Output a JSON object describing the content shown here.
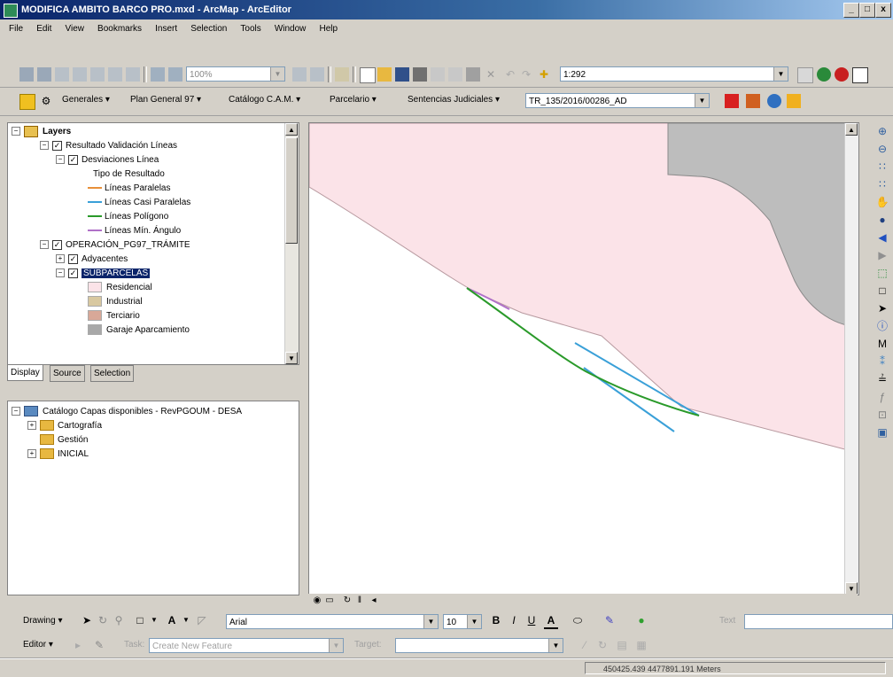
{
  "window": {
    "title": "MODIFICA AMBITO BARCO PRO.mxd - ArcMap - ArcEditor",
    "minimize": "_",
    "restore": "□",
    "close": "x"
  },
  "menu": [
    "File",
    "Edit",
    "View",
    "Bookmarks",
    "Insert",
    "Selection",
    "Tools",
    "Window",
    "Help"
  ],
  "standard_toolbar": {
    "zoom_combo": "100%",
    "scale_combo": "1:292"
  },
  "custom_toolbar": {
    "menus": [
      "Generales ▾",
      "Plan General 97 ▾",
      "Catálogo C.A.M. ▾",
      "Parcelario ▾",
      "Sentencias Judiciales ▾"
    ],
    "expediente_combo": "TR_135/2016/00286_AD"
  },
  "toc": {
    "root": "Layers",
    "items": [
      {
        "label": "Resultado Validación Líneas"
      },
      {
        "label": "Desviaciones Línea"
      },
      {
        "label": "Tipo de Resultado"
      },
      {
        "label": "Líneas Paralelas",
        "color": "#e8903a"
      },
      {
        "label": "Líneas Casi Paralelas",
        "color": "#3aa0d8"
      },
      {
        "label": "Líneas Polígono",
        "color": "#2a9a2a"
      },
      {
        "label": "Líneas Mín. Ángulo",
        "color": "#b070c8"
      },
      {
        "label": "OPERACIÓN_PG97_TRÁMITE"
      },
      {
        "label": "Adyacentes"
      },
      {
        "label": "SUBPARCELAS"
      },
      {
        "label": "Residencial",
        "color": "#fbe3e8"
      },
      {
        "label": "Industrial",
        "color": "#d8c8a0"
      },
      {
        "label": "Terciario",
        "color": "#d8a898"
      },
      {
        "label": "Garaje Aparcamiento",
        "color": "#a8a8a8"
      }
    ],
    "tabs": [
      "Display",
      "Source",
      "Selection"
    ]
  },
  "catalog": {
    "root": "Catálogo Capas disponibles - RevPGOUM - DESA",
    "folders": [
      "Cartografía",
      "Gestión",
      "INICIAL"
    ]
  },
  "drawing_toolbar": {
    "drawing_menu": "Drawing ▾",
    "font": "Arial",
    "size": "10",
    "bold": "B",
    "italic": "I",
    "underline": "U",
    "font_color": "A",
    "text_label": "Text"
  },
  "editor_toolbar": {
    "editor_menu": "Editor ▾",
    "task_label": "Task:",
    "task_value": "Create New Feature",
    "target_label": "Target:"
  },
  "status": {
    "coordinates": "450425.439  4477891.191 Meters"
  },
  "colors": {
    "map_residencial": "#fbe3e8",
    "map_gray": "#bdbdbd",
    "line_paralelas": "#e8903a",
    "line_casi_paralelas": "#3aa0d8",
    "line_poligono": "#2a9a2a",
    "line_min_angulo": "#b070c8"
  }
}
